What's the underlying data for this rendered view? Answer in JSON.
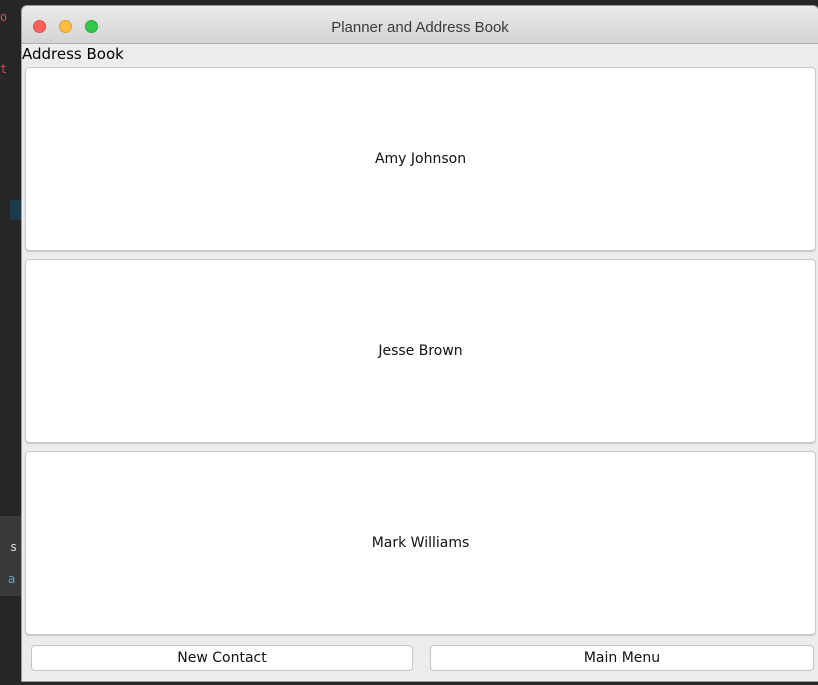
{
  "window": {
    "title": "Planner and Address Book"
  },
  "address_book": {
    "heading": "Address Book",
    "contacts": [
      {
        "name": "Amy Johnson"
      },
      {
        "name": "Jesse Brown"
      },
      {
        "name": "Mark Williams"
      }
    ]
  },
  "buttons": {
    "new_contact": "New Contact",
    "main_menu": "Main Menu"
  },
  "colors": {
    "close": "#fc605c",
    "minimize": "#fdbc40",
    "maximize": "#34c84a",
    "window_background": "#ececec",
    "card_background": "#ffffff"
  }
}
